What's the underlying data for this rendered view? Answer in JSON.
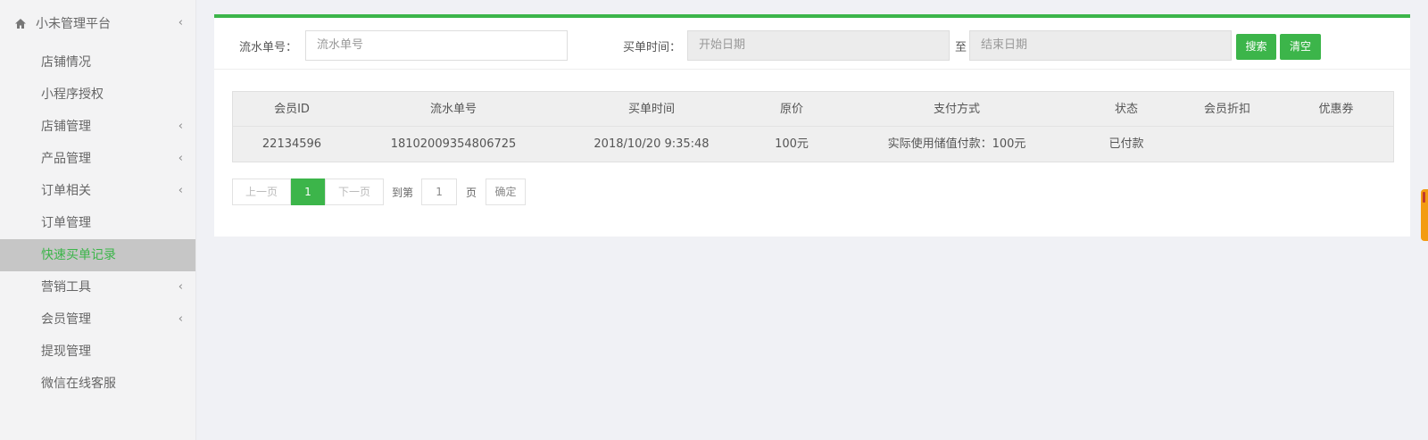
{
  "sidebar": {
    "title": "小未管理平台",
    "items": [
      {
        "label": "店铺情况",
        "arrow": false,
        "active": false
      },
      {
        "label": "小程序授权",
        "arrow": false,
        "active": false
      },
      {
        "label": "店铺管理",
        "arrow": true,
        "active": false
      },
      {
        "label": "产品管理",
        "arrow": true,
        "active": false
      },
      {
        "label": "订单相关",
        "arrow": true,
        "active": false
      },
      {
        "label": "订单管理",
        "arrow": false,
        "active": false
      },
      {
        "label": "快速买单记录",
        "arrow": false,
        "active": true
      },
      {
        "label": "营销工具",
        "arrow": true,
        "active": false
      },
      {
        "label": "会员管理",
        "arrow": true,
        "active": false
      },
      {
        "label": "提现管理",
        "arrow": false,
        "active": false
      },
      {
        "label": "微信在线客服",
        "arrow": false,
        "active": false
      }
    ]
  },
  "search": {
    "serial_label": "流水单号：",
    "serial_placeholder": "流水单号",
    "time_label": "买单时间：",
    "start_placeholder": "开始日期",
    "to_label": "至",
    "end_placeholder": "结束日期",
    "search_button": "搜索",
    "clear_button": "清空"
  },
  "table": {
    "columns": [
      "会员ID",
      "流水单号",
      "买单时间",
      "原价",
      "支付方式",
      "状态",
      "会员折扣",
      "优惠券"
    ],
    "rows": [
      [
        "22134596",
        "18102009354806725",
        "2018/10/20 9:35:48",
        "100元",
        "实际使用储值付款：100元",
        "已付款",
        "",
        ""
      ]
    ]
  },
  "pager": {
    "prev": "上一页",
    "current": "1",
    "next": "下一页",
    "goto_label": "到第",
    "goto_value": "1",
    "page_label": "页",
    "confirm": "确定"
  },
  "colors": {
    "accent": "#3cb54a",
    "sidebar_active_bg": "#c6c6c6"
  },
  "icons": {
    "home": "home-icon",
    "chevron": "chevron-left-icon"
  }
}
